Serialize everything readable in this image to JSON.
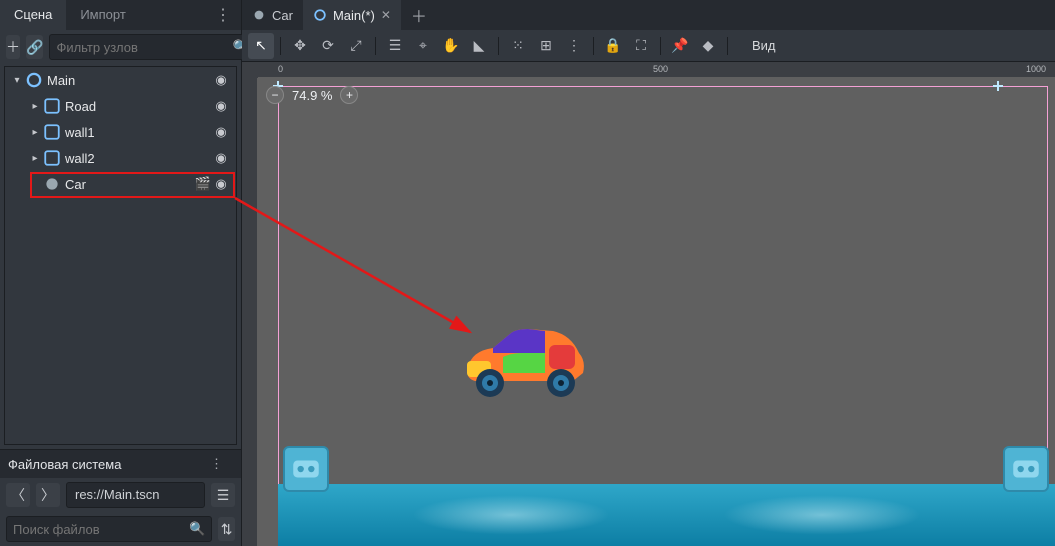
{
  "scene_panel": {
    "tabs": {
      "scene": "Сцена",
      "import": "Импорт"
    },
    "search_placeholder": "Фильтр узлов",
    "nodes": {
      "main": {
        "label": "Main"
      },
      "road": {
        "label": "Road"
      },
      "wall1": {
        "label": "wall1"
      },
      "wall2": {
        "label": "wall2"
      },
      "car": {
        "label": "Car"
      }
    }
  },
  "filesystem_panel": {
    "title": "Файловая система",
    "path": "res://Main.tscn",
    "search_placeholder": "Поиск файлов"
  },
  "doc_tabs": {
    "car": {
      "label": "Car"
    },
    "main": {
      "label": "Main(*)"
    }
  },
  "canvas_toolbar": {
    "view_label": "Вид"
  },
  "zoom": {
    "value": "74.9 %"
  },
  "ruler_marks": {
    "a": "0",
    "b": "500",
    "c": "1000"
  },
  "colors": {
    "highlight": "#e31818",
    "selection": "#f5a1d6",
    "water": "#2fa7c9"
  }
}
